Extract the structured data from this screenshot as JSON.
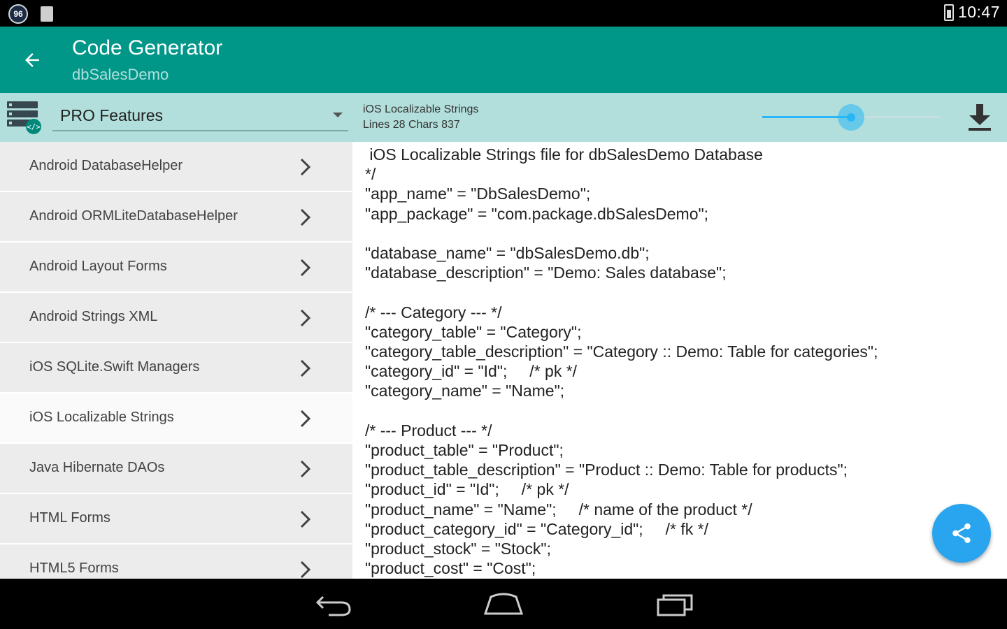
{
  "status_bar": {
    "notification_badge": "96",
    "clock": "10:47"
  },
  "app_bar": {
    "title": "Code Generator",
    "subtitle": "dbSalesDemo",
    "back_icon": "arrow-back-icon"
  },
  "toolbar": {
    "spinner_selected": "PRO Features",
    "file_name": "iOS Localizable Strings",
    "file_stats": "Lines 28 Chars 837",
    "font_size_slider_level": 0.5,
    "accent_color": "#29b6f6",
    "download_icon": "download-icon"
  },
  "sidebar": {
    "items": [
      {
        "label": "Android DatabaseHelper",
        "selected": false
      },
      {
        "label": "Android ORMLiteDatabaseHelper",
        "selected": false
      },
      {
        "label": "Android Layout Forms",
        "selected": false
      },
      {
        "label": "Android Strings XML",
        "selected": false
      },
      {
        "label": "iOS SQLite.Swift Managers",
        "selected": false
      },
      {
        "label": "iOS Localizable Strings",
        "selected": true
      },
      {
        "label": "Java Hibernate DAOs",
        "selected": false
      },
      {
        "label": "HTML Forms",
        "selected": false
      },
      {
        "label": "HTML5 Forms",
        "selected": false
      }
    ]
  },
  "code_view": {
    "lines": [
      " iOS Localizable Strings file for dbSalesDemo Database",
      "*/",
      "\"app_name\" = \"DbSalesDemo\";",
      "\"app_package\" = \"com.package.dbSalesDemo\";",
      "",
      "\"database_name\" = \"dbSalesDemo.db\";",
      "\"database_description\" = \"Demo: Sales database\";",
      "",
      "/* --- Category --- */",
      "\"category_table\" = \"Category\";",
      "\"category_table_description\" = \"Category :: Demo: Table for categories\";",
      "\"category_id\" = \"Id\";     /* pk */",
      "\"category_name\" = \"Name\";",
      "",
      "/* --- Product --- */",
      "\"product_table\" = \"Product\";",
      "\"product_table_description\" = \"Product :: Demo: Table for products\";",
      "\"product_id\" = \"Id\";     /* pk */",
      "\"product_name\" = \"Name\";     /* name of the product */",
      "\"product_category_id\" = \"Category_id\";     /* fk */",
      "\"product_stock\" = \"Stock\";",
      "\"product_cost\" = \"Cost\";"
    ]
  },
  "fab": {
    "icon": "share-icon",
    "color": "#29a4ee"
  },
  "nav_bar": {
    "icons": [
      "back-nav-icon",
      "home-nav-icon",
      "recents-nav-icon"
    ]
  },
  "colors": {
    "primary": "#009688",
    "toolbar": "#b2dfdb"
  }
}
